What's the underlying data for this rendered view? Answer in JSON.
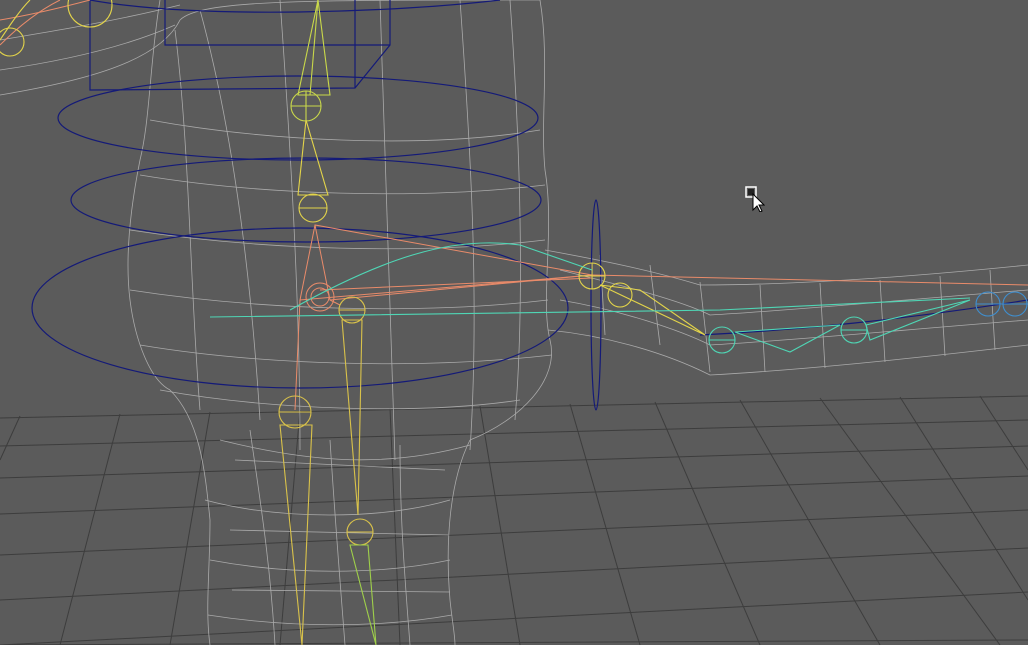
{
  "viewport": {
    "background": "#5b5b5b",
    "grid_color": "#3d3d3d",
    "mesh_color": "#b8b8b8",
    "control_color": "#141a78",
    "spine_color": "#e3d44a",
    "leg_color": "#c7a83f",
    "limb_color": "#e98b6a",
    "arm_color": "#4fd6b5",
    "hand_color": "#3f8fd0",
    "cursor_icon": "move-cursor-icon"
  }
}
